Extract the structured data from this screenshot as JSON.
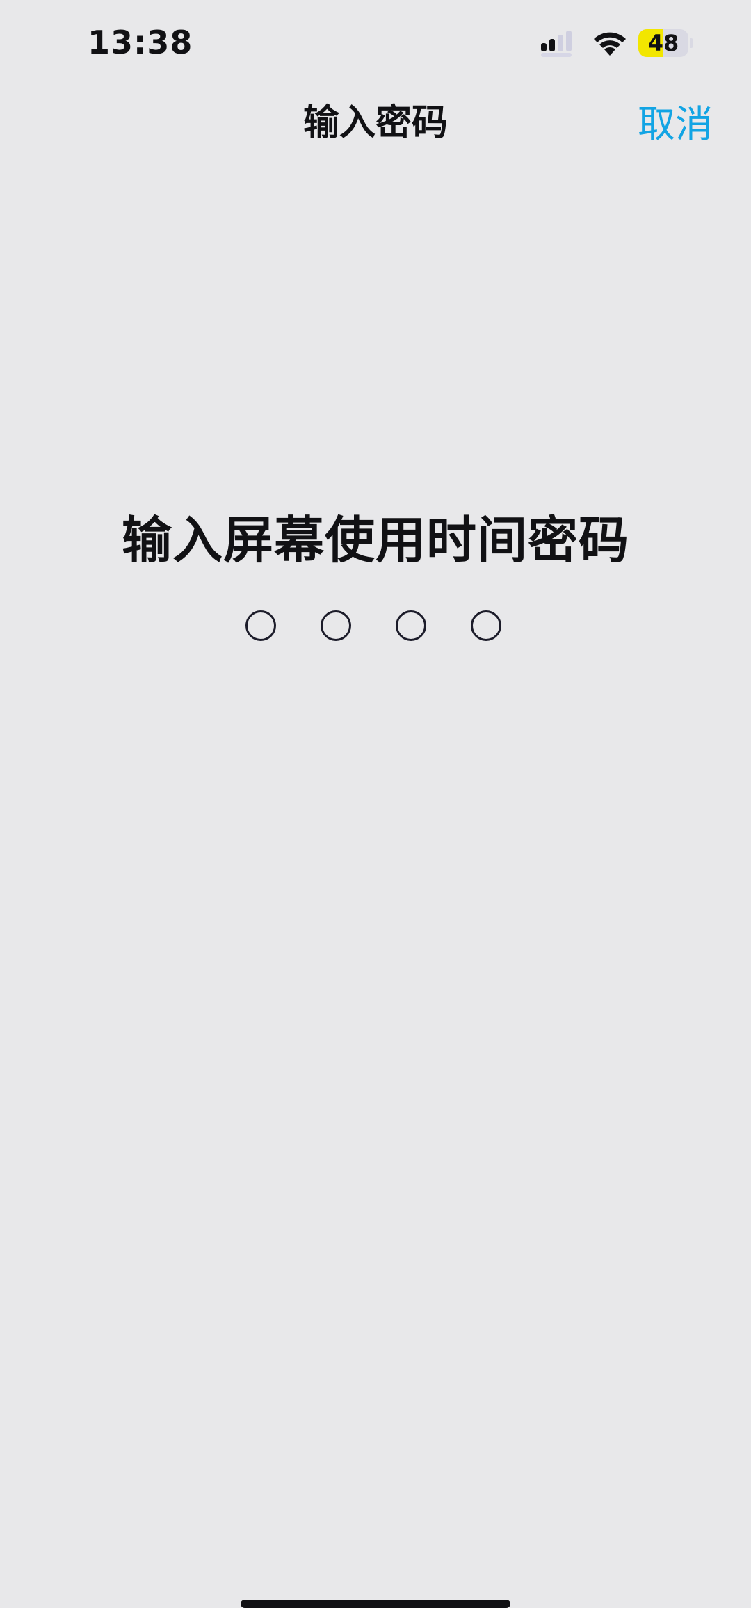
{
  "status_bar": {
    "time": "13:38",
    "battery_level": "48",
    "battery_fraction": 0.48
  },
  "nav": {
    "title": "输入密码",
    "cancel_label": "取消"
  },
  "prompt": {
    "title": "输入屏幕使用时间密码"
  },
  "passcode": {
    "digits_total": 4,
    "digits_entered": 0
  },
  "colors": {
    "background": "#e8e8ea",
    "accent": "#12a4e4",
    "text": "#111114",
    "battery_highlight": "#f2e600"
  }
}
